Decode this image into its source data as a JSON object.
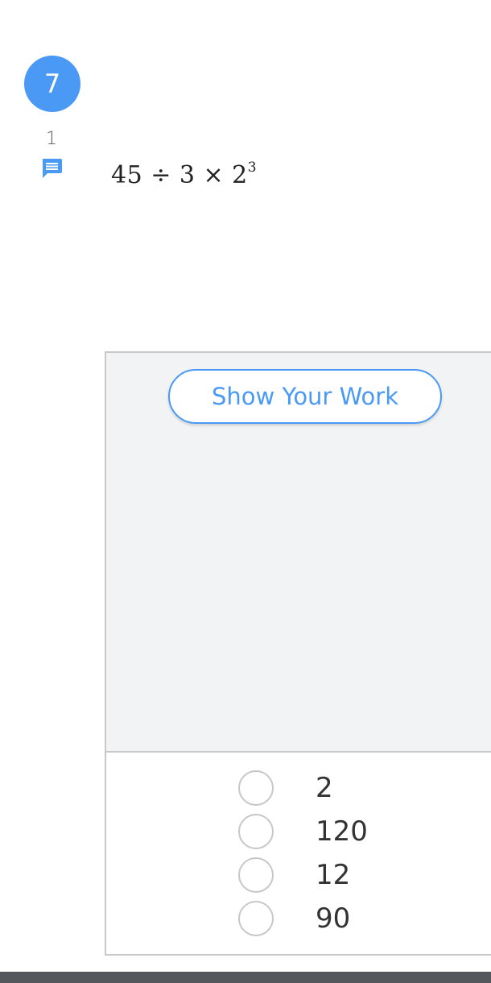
{
  "question": {
    "number": "7",
    "comment_count": "1",
    "comment_icon": "chat-bubble-icon",
    "expression": {
      "main": "45 ÷ 3 × 2",
      "exponent": "3"
    }
  },
  "work": {
    "button_label": "Show Your Work"
  },
  "choices": [
    {
      "label": "2"
    },
    {
      "label": "120"
    },
    {
      "label": "12"
    },
    {
      "label": "90"
    }
  ],
  "colors": {
    "accent": "#4a9af5",
    "panel_bg": "#f2f3f4",
    "border": "#c8c8c8",
    "bottom_bar": "#54585c"
  }
}
